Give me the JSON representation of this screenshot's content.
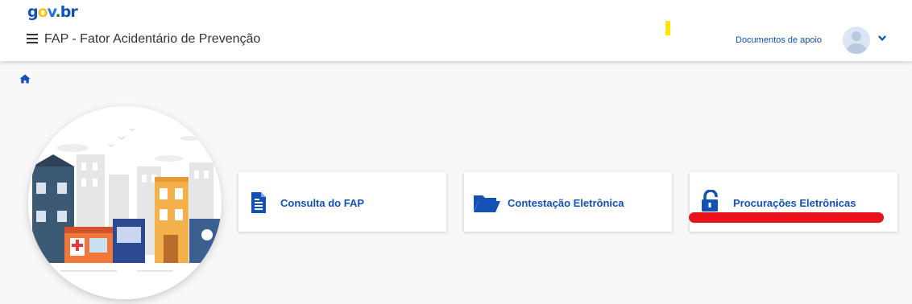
{
  "header": {
    "logo": {
      "g": "g",
      "o": "o",
      "v": "v",
      "dot": ".",
      "br": "br"
    },
    "app_title": "FAP - Fator Acidentário de Prevenção",
    "docs_link": "Documentos de apoio"
  },
  "cards": [
    {
      "label": "Consulta do FAP",
      "icon": "document-icon"
    },
    {
      "label": "Contestação Eletrônica",
      "icon": "folder-open-icon"
    },
    {
      "label": "Procurações Eletrônicas",
      "icon": "unlock-icon"
    }
  ],
  "colors": {
    "primary": "#1351b4",
    "annotation_red": "#e8121a",
    "annotation_yellow": "#ffe600"
  }
}
